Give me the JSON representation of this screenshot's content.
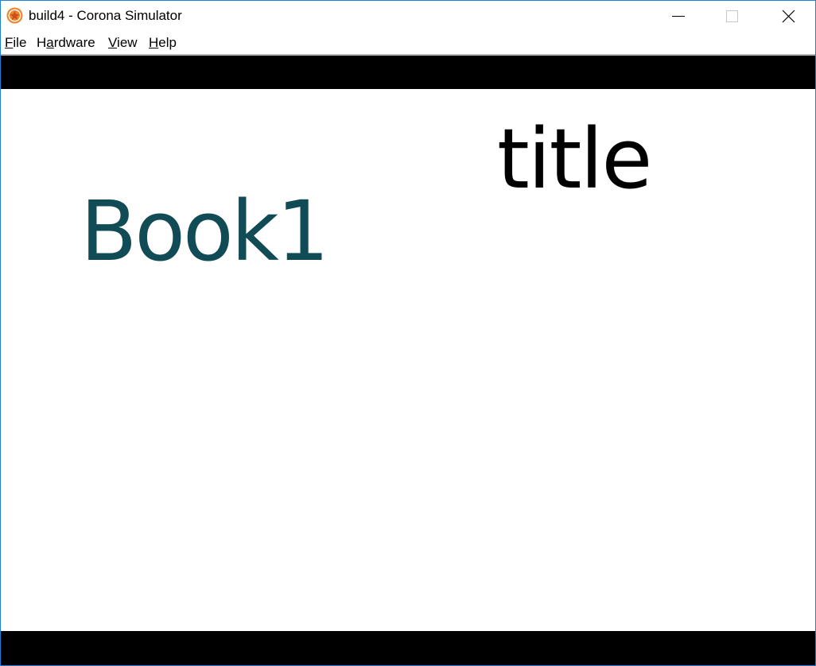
{
  "window": {
    "title": "build4 - Corona Simulator",
    "border_color": "#1e7fd6"
  },
  "titlebar": {
    "app_icon": "corona-logo-icon",
    "minimize_icon": "minimize-icon",
    "maximize_icon": "maximize-icon",
    "close_icon": "close-icon"
  },
  "menubar": {
    "items": [
      {
        "label_pre": "",
        "label_ul": "F",
        "label_post": "ile"
      },
      {
        "label_pre": "H",
        "label_ul": "a",
        "label_post": "rdware"
      },
      {
        "label_pre": "",
        "label_ul": "V",
        "label_post": "iew"
      },
      {
        "label_pre": "",
        "label_ul": "H",
        "label_post": "elp"
      }
    ]
  },
  "simulator": {
    "title_text": "title",
    "book_text": "Book1",
    "book_color": "#114b55",
    "title_color": "#000000",
    "letterbox_color": "#000000",
    "background_color": "#ffffff"
  }
}
